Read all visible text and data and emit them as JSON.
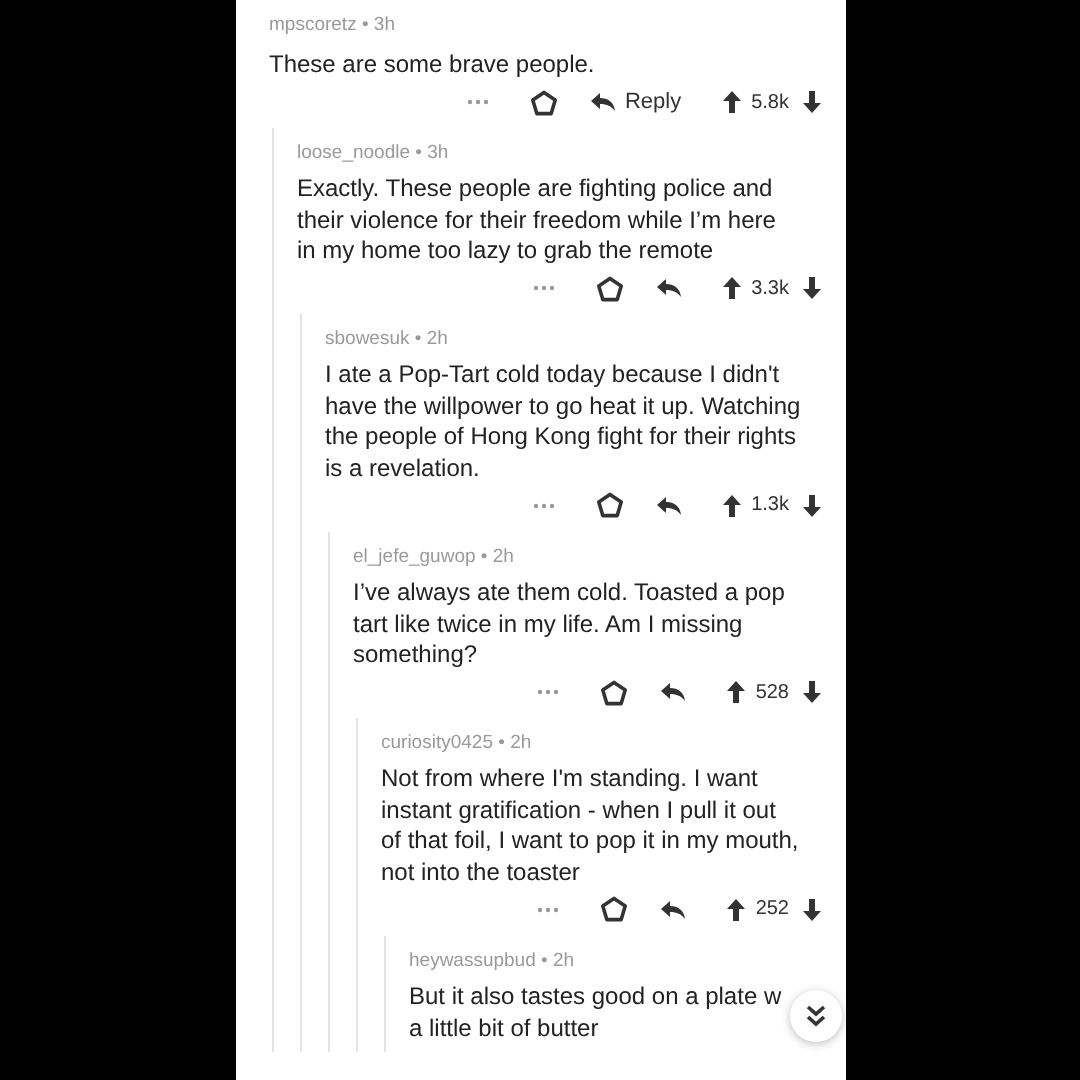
{
  "comments": [
    {
      "byline": "mpscoretz • 3h",
      "lines": [
        "These are some brave people."
      ],
      "actions": {
        "reply_label": "Reply",
        "score": "5.8k"
      },
      "children": [
        {
          "byline": "loose_noodle • 3h",
          "lines": [
            "Exactly. These people are fighting police and",
            "their violence for their freedom while I’m here",
            "in my home too lazy to grab the remote"
          ],
          "actions": {
            "score": "3.3k"
          },
          "children": [
            {
              "byline": "sbowesuk • 2h",
              "lines": [
                "I ate a Pop-Tart cold today because I didn't",
                "have the willpower to go heat it up. Watching",
                "the people of Hong Kong fight for their rights",
                "is a revelation."
              ],
              "actions": {
                "score": "1.3k"
              },
              "children": [
                {
                  "byline": "el_jefe_guwop • 2h",
                  "lines": [
                    "I’ve always ate them cold. Toasted a pop",
                    "tart like twice in my life. Am I missing",
                    "something?"
                  ],
                  "actions": {
                    "score": "528"
                  },
                  "children": [
                    {
                      "byline": "curiosity0425 • 2h",
                      "lines": [
                        "Not from where I'm standing. I want",
                        "instant gratification  - when I pull it out",
                        "of that foil, I want to pop it in my mouth,",
                        "not into the toaster"
                      ],
                      "actions": {
                        "score": "252"
                      },
                      "children": [
                        {
                          "byline": "heywassupbud • 2h",
                          "lines": [
                            "But it also tastes good on a plate w",
                            "a little bit of butter"
                          ]
                        }
                      ]
                    }
                  ]
                }
              ]
            }
          ]
        }
      ]
    }
  ],
  "scroll_button": {
    "kind": "jump-down"
  }
}
